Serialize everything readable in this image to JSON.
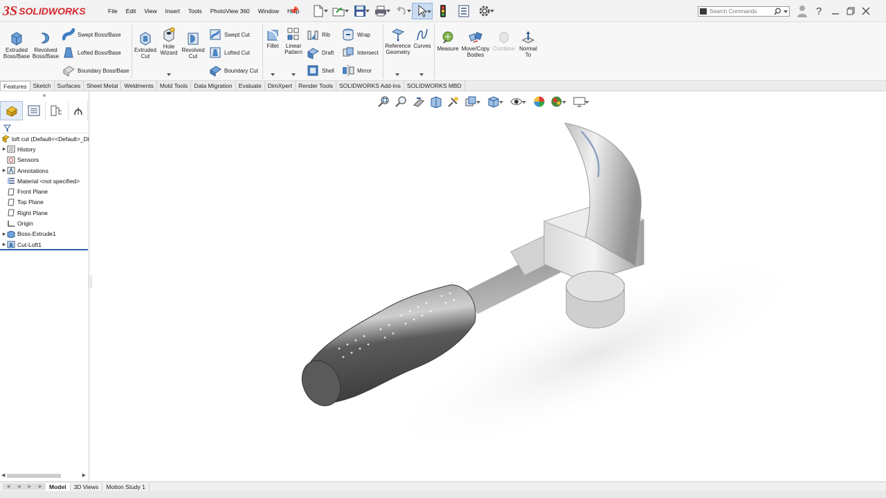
{
  "app": {
    "brand_prefix": "3S",
    "brand_name": "SOLIDWORKS"
  },
  "menu": [
    "File",
    "Edit",
    "View",
    "Insert",
    "Tools",
    "PhotoView 360",
    "Window",
    "Help"
  ],
  "search": {
    "placeholder": "Search Commands"
  },
  "ribbon": {
    "extruded_boss": "Extruded Boss/Base",
    "revolved_boss": "Revolved Boss/Base",
    "swept_boss": "Swept Boss/Base",
    "lofted_boss": "Lofted Boss/Base",
    "boundary_boss": "Boundary Boss/Base",
    "extruded_cut": "Extruded Cut",
    "hole_wizard": "Hole Wizard",
    "revolved_cut": "Revolved Cut",
    "swept_cut": "Swept Cut",
    "lofted_cut": "Lofted Cut",
    "boundary_cut": "Boundary Cut",
    "fillet": "Fillet",
    "linear_pattern": "Linear Pattern",
    "rib": "Rib",
    "draft": "Draft",
    "shell": "Shell",
    "wrap": "Wrap",
    "intersect": "Intersect",
    "mirror": "Mirror",
    "reference_geometry": "Reference Geometry",
    "curves": "Curves",
    "measure": "Measure",
    "move_copy": "Move/Copy Bodies",
    "combine": "Combine",
    "normal_to": "Normal To"
  },
  "tabs": [
    "Features",
    "Sketch",
    "Surfaces",
    "Sheet Metal",
    "Weldments",
    "Mold Tools",
    "Data Migration",
    "Evaluate",
    "DimXpert",
    "Render Tools",
    "SOLIDWORKS Add-Ins",
    "SOLIDWORKS MBD"
  ],
  "active_tab": "Features",
  "tree": {
    "root": "loft cut  (Default<<Default>_Di",
    "items": [
      "History",
      "Sensors",
      "Annotations",
      "Material <not specified>",
      "Front Plane",
      "Top Plane",
      "Right Plane",
      "Origin",
      "Boss-Extrude1",
      "Cut-Loft1"
    ]
  },
  "bottom_tabs": [
    "Model",
    "3D Views",
    "Motion Study 1"
  ],
  "active_bottom_tab": "Model"
}
